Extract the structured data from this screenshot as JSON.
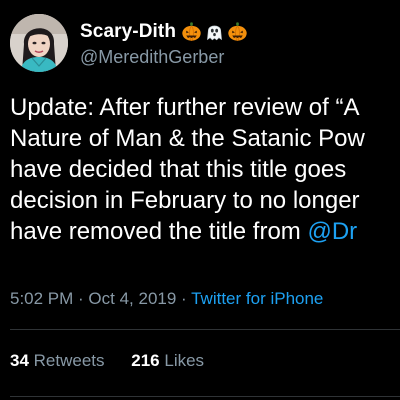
{
  "tweet": {
    "display_name": "Scary-Dith",
    "name_emojis": [
      "jack-o-lantern-icon",
      "ghost-icon",
      "jack-o-lantern-icon"
    ],
    "handle": "@MeredithGerber",
    "body_lines": [
      "Update: After further review of “A",
      "Nature of Man & the Satanic Pow",
      "have decided that this title goes",
      "decision in February to no longer",
      "have removed the title from "
    ],
    "mention": "@Dr",
    "timestamp": "5:02 PM · Oct 4, 2019 · ",
    "source": "Twitter for iPhone",
    "retweets_count": "34",
    "retweets_label": "Retweets",
    "likes_count": "216",
    "likes_label": "Likes"
  },
  "colors": {
    "background": "#000000",
    "text": "#ffffff",
    "secondary": "#8899a6",
    "link": "#1da1f2",
    "divider": "#2f3336"
  }
}
